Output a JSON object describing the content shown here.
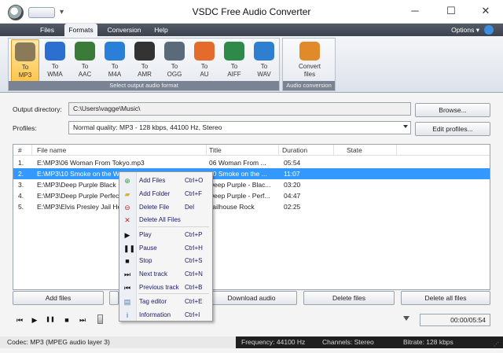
{
  "window": {
    "title": "VSDC Free Audio Converter",
    "controls": {
      "minimize": "─",
      "maximize": "☐",
      "close": "✕"
    }
  },
  "menu": {
    "tabs": [
      "Files",
      "Formats",
      "Conversion",
      "Help"
    ],
    "active_tab": "Formats",
    "options_label": "Options ▾"
  },
  "ribbon": {
    "format_buttons": [
      {
        "label1": "To",
        "label2": "MP3",
        "icon": "mp3-icon",
        "color": "#8a7a5a",
        "selected": true
      },
      {
        "label1": "To",
        "label2": "WMA",
        "icon": "wma-icon",
        "color": "#2c6fd1"
      },
      {
        "label1": "To",
        "label2": "AAC",
        "icon": "aac-icon",
        "color": "#3c7a3a"
      },
      {
        "label1": "To",
        "label2": "M4A",
        "icon": "m4a-icon",
        "color": "#2a7fd8"
      },
      {
        "label1": "To",
        "label2": "AMR",
        "icon": "amr-icon",
        "color": "#333333"
      },
      {
        "label1": "To",
        "label2": "OGG",
        "icon": "ogg-icon",
        "color": "#5a6a7a"
      },
      {
        "label1": "To",
        "label2": "AU",
        "icon": "au-icon",
        "color": "#e46b2c"
      },
      {
        "label1": "To",
        "label2": "AIFF",
        "icon": "aiff-icon",
        "color": "#2f8a4a"
      },
      {
        "label1": "To",
        "label2": "WAV",
        "icon": "wav-icon",
        "color": "#2f7fd1"
      }
    ],
    "format_group_label": "Select output audio format",
    "convert_button": {
      "label1": "Convert",
      "label2": "files",
      "icon": "convert-icon",
      "color": "#e08a2a"
    },
    "convert_group_label": "Audio conversion"
  },
  "form": {
    "output_label": "Output directory:",
    "output_value": "C:\\Users\\vagge\\Music\\",
    "browse_label": "Browse...",
    "profiles_label": "Profiles:",
    "profile_value": "Normal quality: MP3 - 128 kbps, 44100 Hz, Stereo",
    "edit_profiles_label": "Edit profiles..."
  },
  "filelist": {
    "columns": {
      "num": "#",
      "file": "File name",
      "title": "Title",
      "duration": "Duration",
      "state": "State"
    },
    "rows": [
      {
        "num": "1.",
        "file": "E:\\MP3\\06 Woman From Tokyo.mp3",
        "title": "06 Woman From ...",
        "duration": "05:54"
      },
      {
        "num": "2.",
        "file": "E:\\MP3\\10 Smoke on the Wa",
        "title": "10 Smoke on the ...",
        "duration": "11:07"
      },
      {
        "num": "3.",
        "file": "E:\\MP3\\Deep Purple  Black",
        "title": "Deep Purple - Blac...",
        "duration": "03:20"
      },
      {
        "num": "4.",
        "file": "E:\\MP3\\Deep Purple  Perfec",
        "title": "Deep Purple - Perf...",
        "duration": "04:47"
      },
      {
        "num": "5.",
        "file": "E:\\MP3\\Elvis Presley  Jail He",
        "title": "Jailhouse Rock",
        "duration": "02:25"
      }
    ],
    "selected_row": 1
  },
  "context_menu": {
    "items": [
      {
        "label": "Add Files",
        "shortcut": "Ctrl+O",
        "icon": "add-files-icon",
        "glyph": "⊕",
        "color": "#3a9a3a"
      },
      {
        "label": "Add Folder",
        "shortcut": "Ctrl+F",
        "icon": "add-folder-icon",
        "glyph": "▰",
        "color": "#d8b23a"
      },
      {
        "label": "Delete File",
        "shortcut": "Del",
        "icon": "delete-file-icon",
        "glyph": "⊖",
        "color": "#c03030"
      },
      {
        "label": "Delete All Files",
        "shortcut": "",
        "icon": "delete-all-icon",
        "glyph": "✕",
        "color": "#d02020"
      },
      {
        "label": "Play",
        "shortcut": "Ctrl+P",
        "icon": "play-icon",
        "glyph": "▶",
        "color": "#111111"
      },
      {
        "label": "Pause",
        "shortcut": "Ctrl+H",
        "icon": "pause-icon",
        "glyph": "❚❚",
        "color": "#111111"
      },
      {
        "label": "Stop",
        "shortcut": "Ctrl+S",
        "icon": "stop-icon",
        "glyph": "■",
        "color": "#111111"
      },
      {
        "label": "Next track",
        "shortcut": "Ctrl+N",
        "icon": "next-track-icon",
        "glyph": "⏭",
        "color": "#111111"
      },
      {
        "label": "Previous track",
        "shortcut": "Ctrl+B",
        "icon": "previous-track-icon",
        "glyph": "⏮",
        "color": "#111111"
      },
      {
        "label": "Tag editor",
        "shortcut": "Ctrl+E",
        "icon": "tag-editor-icon",
        "glyph": "▤",
        "color": "#4a7ab0"
      },
      {
        "label": "Information",
        "shortcut": "Ctrl+I",
        "icon": "information-icon",
        "glyph": "i",
        "color": "#2a5ab8"
      }
    ]
  },
  "actions": {
    "add_files": "Add files",
    "download_audio": "Download audio",
    "delete_files": "Delete files",
    "delete_all_files": "Delete all files"
  },
  "player": {
    "time": "00:00/05:54",
    "buttons": [
      "⏮",
      "▶",
      "❚❚",
      "■",
      "⏭"
    ]
  },
  "status": {
    "codec": "Codec: MP3 (MPEG audio layer 3)",
    "frequency": "Frequency: 44100 Hz",
    "channels": "Channels: Stereo",
    "bitrate": "Bitrate: 128 kbps"
  }
}
